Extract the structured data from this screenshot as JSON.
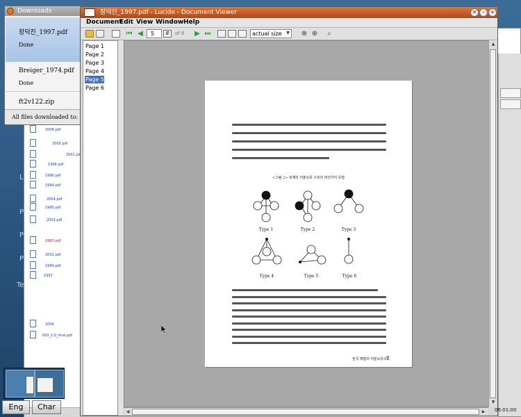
{
  "downloads": {
    "title": "Downloads",
    "items": [
      {
        "name": "장덕진_1997.pdf",
        "status": "Done"
      },
      {
        "name": "Breiger_1974.pdf",
        "status": "Done"
      },
      {
        "name": "ft2v122.zip",
        "status": ""
      }
    ],
    "footer": "All files downloaded to:"
  },
  "lucide": {
    "title": "장덕진_1997.pdf - Lucide - Document Viewer",
    "menu": [
      "Document",
      "Edit",
      "View",
      "Window",
      "Help"
    ],
    "page_current": "5",
    "page_of": "of 6",
    "zoom": "actual size",
    "pages": [
      "Page 1",
      "Page 2",
      "Page 3",
      "Page 4",
      "Page 5",
      "Page 6"
    ],
    "selected_page": 4
  },
  "pdf_page": {
    "figure_caption": "<그림 2> 외계의 지분소유 구조의 여섯가지 유형",
    "types": [
      "Type 1",
      "Type 2",
      "Type 3",
      "Type 4",
      "Type 5",
      "Type 6"
    ],
    "footer_text": "한국 재벌의 지분소유구조",
    "page_number": "7"
  },
  "taskbar": {
    "eng_label": "Eng",
    "char_label": "Char",
    "clock": "06:01:00"
  },
  "background_browser": {
    "links": [
      "2008.pdf",
      "2005.pdf",
      "2001.pdf",
      "1998.pdf",
      "1996.pdf",
      "1994.pdf",
      "2004.pdf",
      "1995.pdf",
      "2003.pdf",
      "1997.pdf",
      "2002.pdf",
      "1999.pdf",
      "1997",
      "2006",
      "000_2.0_final.pdf"
    ],
    "sidebar_letters": [
      "L",
      "P",
      "P",
      "P",
      "Te"
    ]
  },
  "colors": {
    "titlebar_accent": "#c85a24",
    "selection": "#3f6fc0",
    "toolbar_arrows": "#2f9a2f"
  }
}
